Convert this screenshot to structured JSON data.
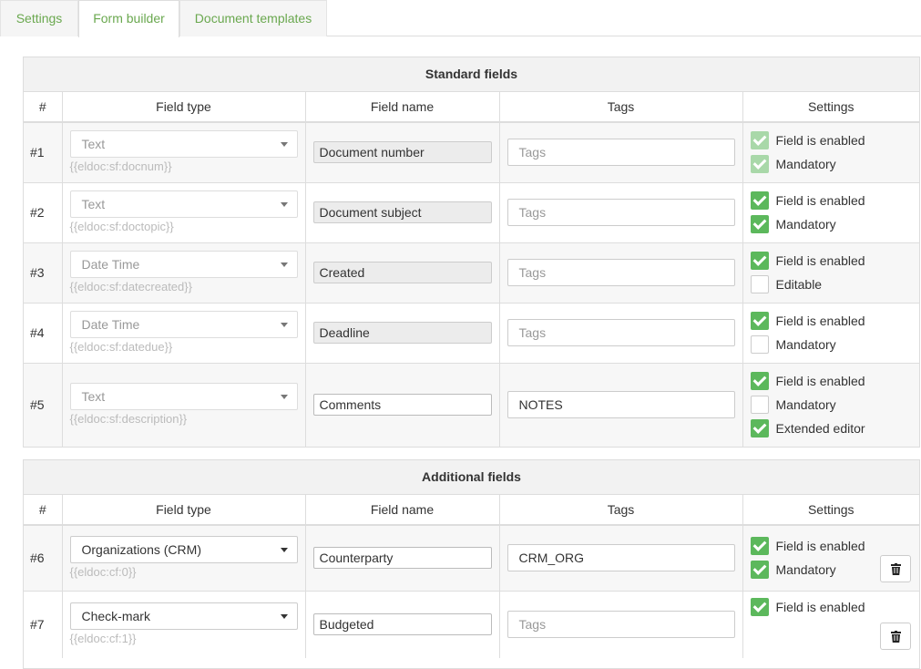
{
  "tabs": [
    {
      "label": "Settings"
    },
    {
      "label": "Form builder"
    },
    {
      "label": "Document templates"
    }
  ],
  "columns": {
    "num": "#",
    "field_type": "Field type",
    "field_name": "Field name",
    "tags": "Tags",
    "settings": "Settings"
  },
  "standard": {
    "title": "Standard fields",
    "rows": [
      {
        "num": "#1",
        "type": "Text",
        "code": "{{eldoc:sf:docnum}}",
        "name": "Document number",
        "tags": "Tags",
        "checks": [
          {
            "label": "Field is enabled",
            "checked": true
          },
          {
            "label": "Mandatory",
            "checked": true
          }
        ]
      },
      {
        "num": "#2",
        "type": "Text",
        "code": "{{eldoc:sf:doctopic}}",
        "name": "Document subject",
        "tags": "Tags",
        "checks": [
          {
            "label": "Field is enabled",
            "checked": true
          },
          {
            "label": "Mandatory",
            "checked": true
          }
        ]
      },
      {
        "num": "#3",
        "type": "Date Time",
        "code": "{{eldoc:sf:datecreated}}",
        "name": "Created",
        "tags": "Tags",
        "checks": [
          {
            "label": "Field is enabled",
            "checked": true
          },
          {
            "label": "Editable",
            "checked": false
          }
        ]
      },
      {
        "num": "#4",
        "type": "Date Time",
        "code": "{{eldoc:sf:datedue}}",
        "name": "Deadline",
        "tags": "Tags",
        "checks": [
          {
            "label": "Field is enabled",
            "checked": true
          },
          {
            "label": "Mandatory",
            "checked": false
          }
        ]
      },
      {
        "num": "#5",
        "type": "Text",
        "code": "{{eldoc:sf:description}}",
        "name": "Comments",
        "tags": "NOTES",
        "checks": [
          {
            "label": "Field is enabled",
            "checked": true
          },
          {
            "label": "Mandatory",
            "checked": false
          },
          {
            "label": "Extended editor",
            "checked": true
          }
        ]
      }
    ]
  },
  "additional": {
    "title": "Additional fields",
    "rows": [
      {
        "num": "#6",
        "type": "Organizations (CRM)",
        "code": "{{eldoc:cf:0}}",
        "name": "Counterparty",
        "tags": "CRM_ORG",
        "checks": [
          {
            "label": "Field is enabled",
            "checked": true
          },
          {
            "label": "Mandatory",
            "checked": true
          }
        ]
      },
      {
        "num": "#7",
        "type": "Check-mark",
        "code": "{{eldoc:cf:1}}",
        "name": "Budgeted",
        "tags": "Tags",
        "checks": [
          {
            "label": "Field is enabled",
            "checked": true
          }
        ]
      }
    ]
  },
  "colors": {
    "accent": "#6aa84f",
    "checkbox": "#5cb85c"
  }
}
